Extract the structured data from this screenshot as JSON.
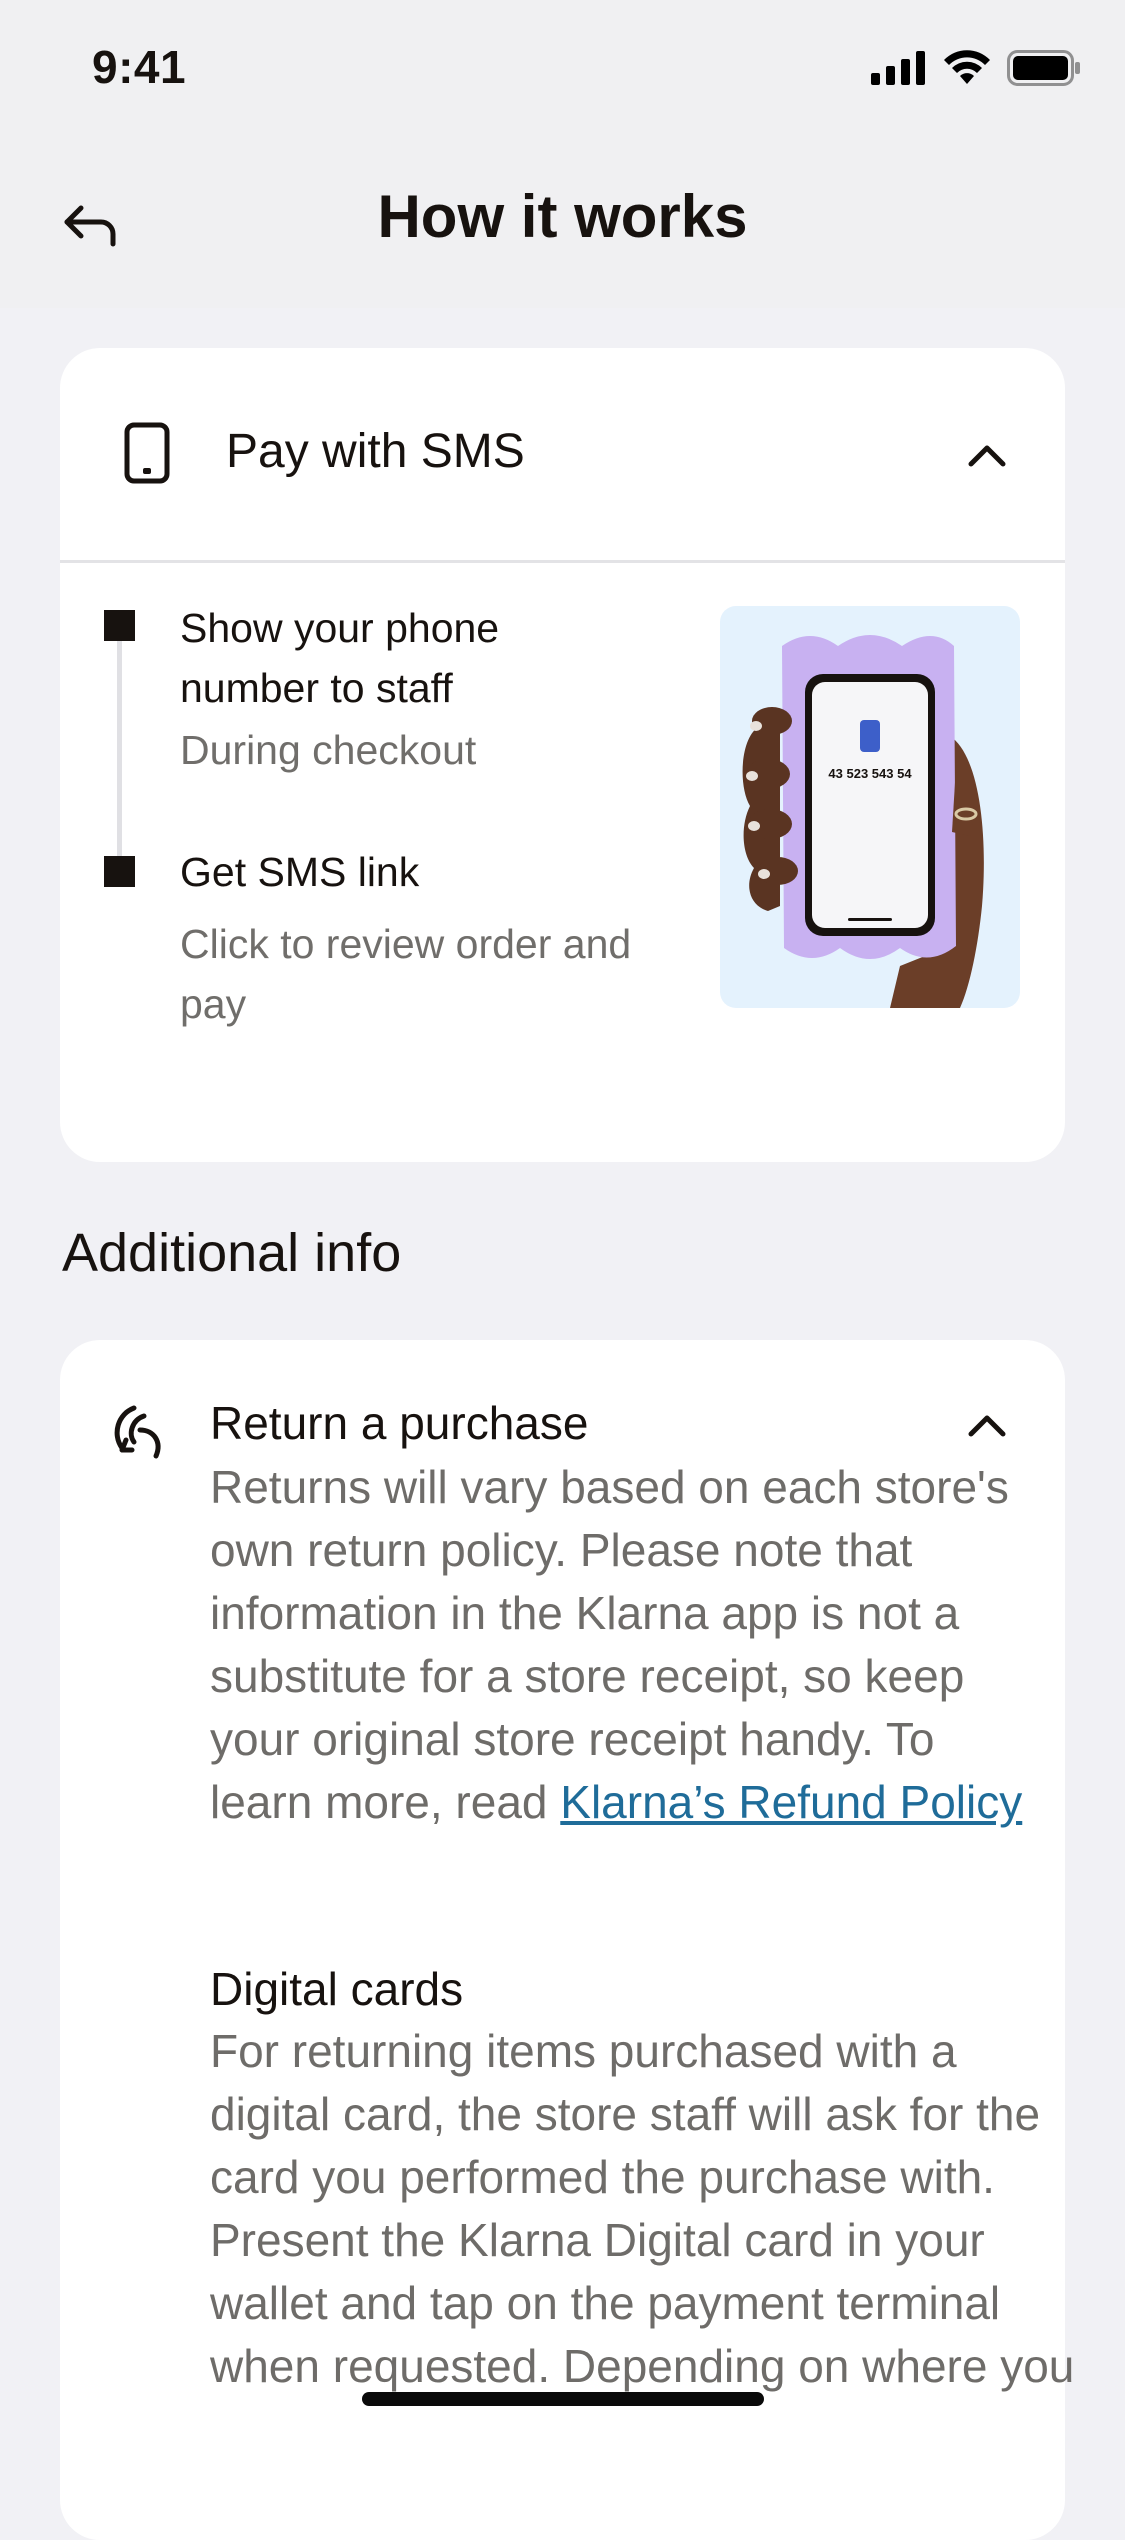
{
  "status_bar": {
    "time": "9:41"
  },
  "header": {
    "title": "How it works",
    "back_icon": "back-arrow-icon"
  },
  "sms_card": {
    "title": "Pay with SMS",
    "icon": "phone-icon",
    "expanded": true,
    "steps": [
      {
        "title": "Show your phone number to staff",
        "subtitle": "During checkout"
      },
      {
        "title": "Get SMS link",
        "subtitle": "Click to review order and pay"
      }
    ],
    "illustration": {
      "phone_number": "43 523 543 54"
    }
  },
  "additional_info": {
    "title": "Additional info",
    "item": {
      "title": "Return a purchase",
      "icon": "return-icon",
      "expanded": true,
      "body": "Returns will vary based on each store's own return policy. Please note that information in the Klarna app is not a substitute for a store receipt, so keep your original store receipt handy. To learn more, read",
      "link": "Klarna’s Refund Policy",
      "sub_title": "Digital cards",
      "sub_body": "For returning items purchased with a digital card, the store staff will ask for the card you performed the purchase with. Present the Klarna Digital card in your wallet and tap on the payment terminal when requested. Depending on where you"
    }
  },
  "colors": {
    "link": "#1f6c99",
    "background": "#f1f1f5",
    "illustration_bg": "#e4f2fd",
    "case": "#c8b1f1"
  }
}
